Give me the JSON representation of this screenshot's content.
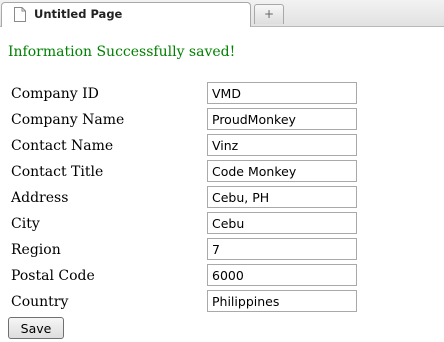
{
  "browser": {
    "tab_title": "Untitled Page",
    "new_tab_glyph": "+",
    "tab_icon": "page-icon"
  },
  "status_message": "Information Successfully saved!",
  "colors": {
    "status_text": "#008000"
  },
  "form": {
    "fields": [
      {
        "label": "Company ID",
        "value": "VMD"
      },
      {
        "label": "Company Name",
        "value": "ProudMonkey"
      },
      {
        "label": "Contact Name",
        "value": "Vinz"
      },
      {
        "label": "Contact Title",
        "value": "Code Monkey"
      },
      {
        "label": "Address",
        "value": "Cebu, PH"
      },
      {
        "label": "City",
        "value": "Cebu"
      },
      {
        "label": "Region",
        "value": "7"
      },
      {
        "label": "Postal Code",
        "value": "6000"
      },
      {
        "label": "Country",
        "value": "Philippines"
      }
    ],
    "save_label": "Save"
  }
}
